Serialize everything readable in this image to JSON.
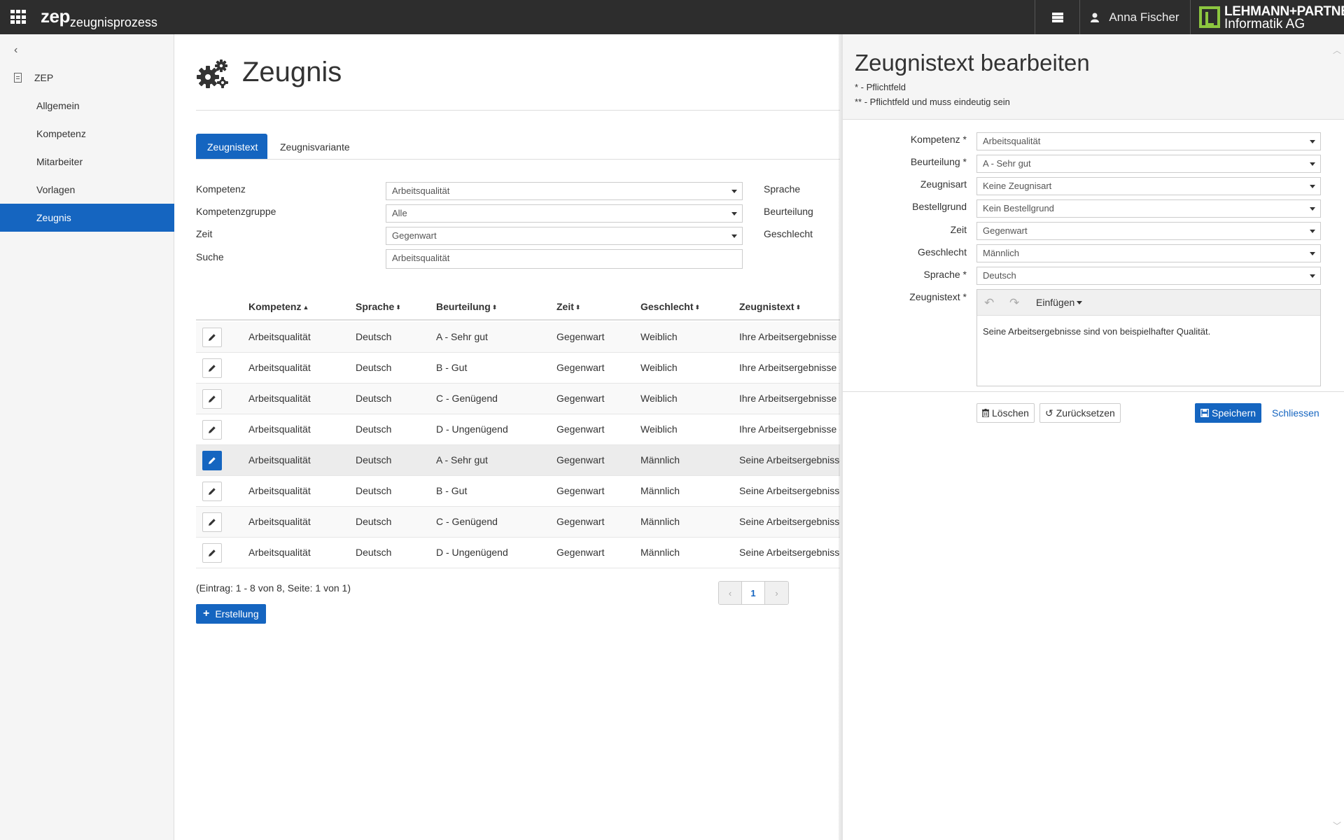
{
  "topbar": {
    "brand_main": "zep",
    "brand_sub": "zeugnisprozess",
    "user_name": "Anna Fischer",
    "company_line1": "LEHMANN+PARTNER",
    "company_line2": "Informatik AG"
  },
  "sidebar": {
    "root_label": "ZEP",
    "items": [
      {
        "label": "Allgemein"
      },
      {
        "label": "Kompetenz"
      },
      {
        "label": "Mitarbeiter"
      },
      {
        "label": "Vorlagen"
      },
      {
        "label": "Zeugnis",
        "active": true
      }
    ]
  },
  "main": {
    "title": "Zeugnis",
    "tabs": [
      {
        "label": "Zeugnistext",
        "active": true
      },
      {
        "label": "Zeugnisvariante"
      }
    ],
    "filters": {
      "kompetenz_label": "Kompetenz",
      "kompetenz_value": "Arbeitsqualität",
      "gruppe_label": "Kompetenzgruppe",
      "gruppe_value": "Alle",
      "zeit_label": "Zeit",
      "zeit_value": "Gegenwart",
      "suche_label": "Suche",
      "suche_value": "Arbeitsqualität",
      "sprache_label": "Sprache",
      "beurteilung_label": "Beurteilung",
      "geschlecht_label": "Geschlecht"
    },
    "table": {
      "columns": [
        "Kompetenz",
        "Sprache",
        "Beurteilung",
        "Zeit",
        "Geschlecht",
        "Zeugnistext"
      ],
      "rows": [
        [
          "Arbeitsqualität",
          "Deutsch",
          "A - Sehr gut",
          "Gegenwart",
          "Weiblich",
          "Ihre Arbeitsergebnisse s"
        ],
        [
          "Arbeitsqualität",
          "Deutsch",
          "B - Gut",
          "Gegenwart",
          "Weiblich",
          "Ihre Arbeitsergebnisse s"
        ],
        [
          "Arbeitsqualität",
          "Deutsch",
          "C - Genügend",
          "Gegenwart",
          "Weiblich",
          "Ihre Arbeitsergebnisse s"
        ],
        [
          "Arbeitsqualität",
          "Deutsch",
          "D - Ungenügend",
          "Gegenwart",
          "Weiblich",
          "Ihre Arbeitsergebnisse e"
        ],
        [
          "Arbeitsqualität",
          "Deutsch",
          "A - Sehr gut",
          "Gegenwart",
          "Männlich",
          "Seine Arbeitsergebnisse"
        ],
        [
          "Arbeitsqualität",
          "Deutsch",
          "B - Gut",
          "Gegenwart",
          "Männlich",
          "Seine Arbeitsergebnisse"
        ],
        [
          "Arbeitsqualität",
          "Deutsch",
          "C - Genügend",
          "Gegenwart",
          "Männlich",
          "Seine Arbeitsergebnisse"
        ],
        [
          "Arbeitsqualität",
          "Deutsch",
          "D - Ungenügend",
          "Gegenwart",
          "Männlich",
          "Seine Arbeitsergebnisse"
        ]
      ]
    },
    "entry_info": "(Eintrag: 1 - 8 von 8, Seite: 1 von 1)",
    "pager": {
      "prev": "‹",
      "current": "1",
      "next": "›"
    },
    "create_label": "Erstellung"
  },
  "panel": {
    "title": "Zeugnistext bearbeiten",
    "note1": "* - Pflichtfeld",
    "note2": "** - Pflichtfeld und muss eindeutig sein",
    "fields": [
      {
        "label": "Kompetenz *",
        "value": "Arbeitsqualität"
      },
      {
        "label": "Beurteilung *",
        "value": "A - Sehr gut"
      },
      {
        "label": "Zeugnisart",
        "value": "Keine Zeugnisart"
      },
      {
        "label": "Bestellgrund",
        "value": "Kein Bestellgrund"
      },
      {
        "label": "Zeit",
        "value": "Gegenwart"
      },
      {
        "label": "Geschlecht",
        "value": "Männlich"
      },
      {
        "label": "Sprache *",
        "value": "Deutsch"
      }
    ],
    "text_label": "Zeugnistext *",
    "editor_insert": "Einfügen",
    "editor_text": "Seine Arbeitsergebnisse sind von beispielhafter Qualität.",
    "delete_label": "Löschen",
    "reset_label": "Zurücksetzen",
    "save_label": "Speichern",
    "close_label": "Schliessen"
  },
  "colors": {
    "topbar": "#2d2d2d",
    "accent": "#1565c0",
    "logo_green": "#8cc63f"
  },
  "icons": [
    "apps-grid-icon",
    "cards-icon",
    "user-icon",
    "back-chevron-icon",
    "document-icon",
    "gears-icon",
    "pencil-icon",
    "sort-icon",
    "plus-icon",
    "undo-icon",
    "redo-icon",
    "trash-icon",
    "reset-icon",
    "save-icon"
  ]
}
